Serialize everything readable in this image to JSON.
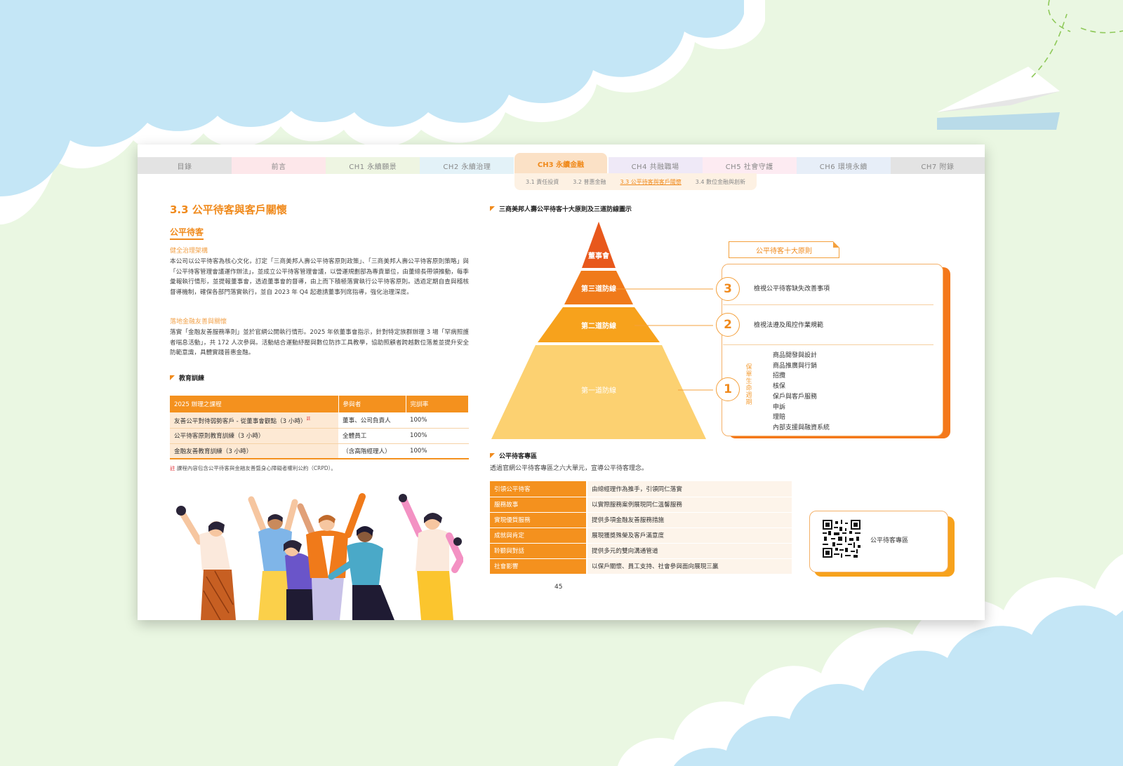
{
  "tabs": [
    "目錄",
    "前言",
    "CH1 永續願景",
    "CH2 永續治理",
    "CH3 永續金融",
    "CH4 共融職場",
    "CH5 社會守護",
    "CH6 環境永續",
    "CH7 附錄"
  ],
  "active_tab": "CH3 永續金融",
  "subnav": [
    "3.1 責任投資",
    "3.2 普惠金融",
    "3.3 公平待客與客戶關懷",
    "3.4 數位金融與創新"
  ],
  "left": {
    "title": "3.3 公平待客與客戶關懷",
    "subtitle": "公平待客",
    "label1": "健全治理架構",
    "para1": "本公司以公平待客為核心文化，訂定「三商美邦人壽公平待客原則政策」、「三商美邦人壽公平待客原則策略」與「公平待客管理會議運作辦法」，並成立公平待客管理會議，以營運規劃部為專責單位，由董總長帶領推動，每季彙報執行情形，並提報董事會，透過董事會的督導，由上而下積極落實執行公平待客原則。透過定期自查與稽核督導機制，確保各部門落實執行，並自 2023 年 Q4 起邀請董事列席指導，強化治理深度。",
    "label2": "落地金融友善與關懷",
    "para2": "落實「金融友善服務準則」並於官網公開執行情形。2025 年依董事會指示，針對特定族群辦理 3 場「罕病照護者喘息活動」，共 172 人次參與。活動結合運動紓壓與數位防詐工具教學，協助照顧者跨越數位落差並提升安全防範意識，具體實踐普惠金融。",
    "training_title": "教育訓練",
    "training_headers": [
      "2025 辦理之課程",
      "參與者",
      "完訓率"
    ],
    "training_rows": [
      [
        "友善公平對待弱勢客戶 - 從董事會觀點（3 小時）",
        "董事、公司負責人",
        "100%"
      ],
      [
        "公平待客原則教育訓練（3 小時）",
        "全體員工",
        "100%"
      ],
      [
        "金融友善教育訓練（3 小時）",
        "（含高階經理人）",
        "100%"
      ]
    ],
    "note_mark": "註",
    "note": "課程內容包含公平待客與金融友善暨身心障礙者權利公約（CRPD）。"
  },
  "right": {
    "pyramid_title": "三商美邦人壽公平待客十大原則及三道防線圖示",
    "pyramid_levels": [
      "董事會",
      "第三道防線",
      "第二道防線",
      "第一道防線"
    ],
    "principles_tag": "公平待客十大原則",
    "rings": [
      "3",
      "2",
      "1"
    ],
    "row3": "檢視公平待客缺失改善事項",
    "row2": "檢視法遵及風控作業規範",
    "vertical_label": "保單生命週期",
    "lifecycle": [
      "商品開發與設計",
      "商品推廣與行銷",
      "招攬",
      "核保",
      "保戶與客戶服務",
      "申訴",
      "理賠",
      "內部支援與融資系統"
    ],
    "zone_title": "公平待客專區",
    "zone_desc": "透過官網公平待客專區之六大單元，宣導公平待客理念。",
    "zone_rows": [
      [
        "引領公平待客",
        "由總經理作為推手，引領同仁落實"
      ],
      [
        "服務故事",
        "以實際服務案例展現同仁溫馨服務"
      ],
      [
        "實現優質服務",
        "提供多項金融友善服務措施"
      ],
      [
        "成就與肯定",
        "展現獲獎殊榮及客戶滿意度"
      ],
      [
        "聆聽與對話",
        "提供多元的雙向溝通管道"
      ],
      [
        "社會影響",
        "以保戶關懷、員工支持、社會參與面向展現三贏"
      ]
    ],
    "qr_label": "公平待客專區"
  },
  "page_number": "45",
  "colors": {
    "accent": "#f4911e",
    "accent_dark": "#f08a1c",
    "sky": "#cbeaf7",
    "ground": "#eaf7e2"
  }
}
